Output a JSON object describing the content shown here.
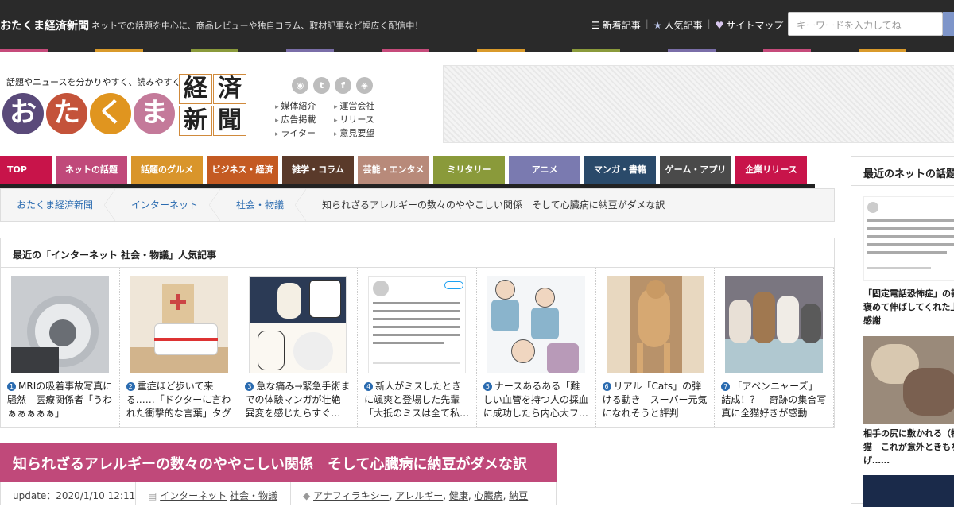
{
  "topbar": {
    "site_name": "おたくま経済新聞",
    "tagline": "ネットでの話題を中心に、商品レビューや独自コラム、取材記事など幅広く配信中！",
    "links": [
      {
        "icon": "list-icon",
        "label": "新着記事"
      },
      {
        "icon": "star-icon",
        "label": "人気記事"
      },
      {
        "icon": "heart-icon",
        "label": "サイトマップ"
      }
    ],
    "search_placeholder": "キーワードを入力してね"
  },
  "stripe_colors": [
    "#c64b7b",
    "#2a2a2a",
    "#d99a2b",
    "#2a2a2a",
    "#8a9a3b",
    "#2a2a2a",
    "#7a6ea8",
    "#2a2a2a",
    "#c64b7b",
    "#2a2a2a",
    "#d99a2b",
    "#2a2a2a",
    "#8a9a3b",
    "#2a2a2a",
    "#7a6ea8",
    "#2a2a2a",
    "#c64b7b",
    "#2a2a2a",
    "#d99a2b",
    "#2a2a2a"
  ],
  "header": {
    "catchphrase": "話題やニュースを分かりやすく、読みやすく。",
    "logo_chars": [
      {
        "char": "お",
        "color": "#5a4a7a"
      },
      {
        "char": "た",
        "color": "#c4533a"
      },
      {
        "char": "く",
        "color": "#e0951f"
      },
      {
        "char": "ま",
        "color": "#c47a9a"
      }
    ],
    "logo_kanji": [
      "経",
      "済",
      "新",
      "聞"
    ],
    "social_icons": [
      "rss-icon",
      "twitter-icon",
      "facebook-icon",
      "feedly-icon"
    ],
    "links_col1": [
      "媒体紹介",
      "広告掲載",
      "ライター"
    ],
    "links_col2": [
      "運営会社",
      "リリース",
      "意見要望"
    ]
  },
  "nav": [
    {
      "label": "TOP",
      "color": "#c8144a",
      "w": 65
    },
    {
      "label": "ネットの話題",
      "color": "#c0497a",
      "w": 90
    },
    {
      "label": "話題のグルメ",
      "color": "#d9952b",
      "w": 90
    },
    {
      "label": "ビジネス・経済",
      "color": "#c45a22",
      "w": 90
    },
    {
      "label": "雑学・コラム",
      "color": "#5a3a2a",
      "w": 90
    },
    {
      "label": "芸能・エンタメ",
      "color": "#b88a7a",
      "w": 90
    },
    {
      "label": "ミリタリー",
      "color": "#8a9a3a",
      "w": 90
    },
    {
      "label": "アニメ",
      "color": "#7a7ab0",
      "w": 90
    },
    {
      "label": "マンガ・書籍",
      "color": "#2a4a6a",
      "w": 90
    },
    {
      "label": "ゲーム・アプリ",
      "color": "#4a4a4a",
      "w": 90
    },
    {
      "label": "企業リリース",
      "color": "#c8144a",
      "w": 90
    }
  ],
  "breadcrumb": [
    "おたくま経済新聞",
    "インターネット",
    "社会・物議",
    "知られざるアレルギーの数々のややこしい関係　そして心臓病に納豆がダメな訳"
  ],
  "popular": {
    "heading": "最近の「インターネット 社会・物議」人気記事",
    "items": [
      {
        "num": "1",
        "title": "MRIの吸着事故写真に騒然　医療関係者「うわぁぁぁぁぁ」",
        "bg": "#9aa0a6"
      },
      {
        "num": "2",
        "title": "重症ほど歩いて来る……「ドクターに言われた衝撃的な言葉」タグ",
        "bg": "#e8d8c0"
      },
      {
        "num": "3",
        "title": "急な痛み→緊急手術までの体験マンガが壮絶　異変を感じたらすぐ…",
        "bg": "#f0ece4"
      },
      {
        "num": "4",
        "title": "新人がミスしたときに颯爽と登場した先輩「大抵のミスは全て私…",
        "bg": "#f7f7f7"
      },
      {
        "num": "5",
        "title": "ナースあるある「難しい血管を持つ人の採血に成功したら内心大フ…",
        "bg": "#eef0f4"
      },
      {
        "num": "6",
        "title": "リアル「Cats」の弾ける動き　スーパー元気になれそうと評判",
        "bg": "#c9a078"
      },
      {
        "num": "7",
        "title": "「アベンニャーズ」結成！？　奇跡の集合写真に全猫好きが感動",
        "bg": "#8a8a9a"
      }
    ]
  },
  "article": {
    "title": "知られざるアレルギーの数々のややこしい関係　そして心臓病に納豆がダメな訳",
    "update": "update：2020/1/10 12:11",
    "categories": [
      "インターネット",
      "社会・物議"
    ],
    "tags": [
      "アナフィラキシー",
      "アレルギー",
      "健康",
      "心臓病",
      "納豆"
    ]
  },
  "sidebar": {
    "heading": "最近のネットの話題",
    "items": [
      {
        "title_lines": [
          "「固定電話恐怖症」の新",
          "褒めて伸ばしてくれた上",
          "感謝"
        ]
      },
      {
        "title_lines": [
          "相手の尻に敷かれる（物",
          "猫　これが意外ときもち",
          "げ……"
        ]
      }
    ]
  }
}
